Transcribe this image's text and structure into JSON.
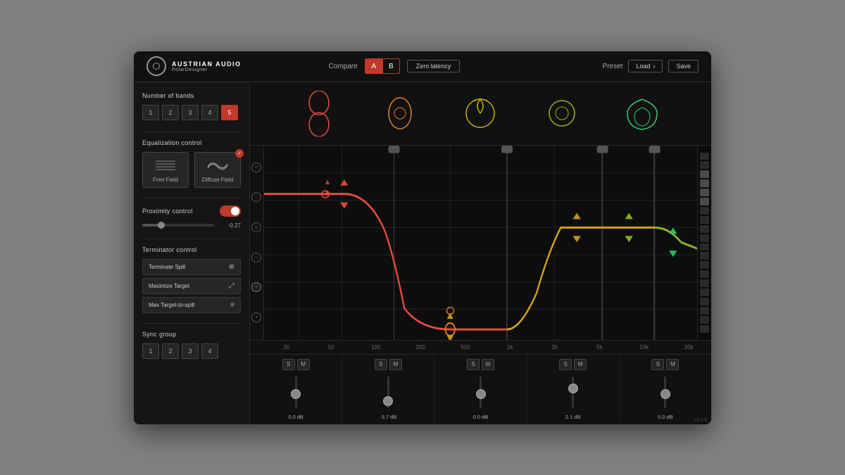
{
  "header": {
    "brand": "AUSTRIAN AUDIO",
    "product": "PolarDesigner",
    "compare_label": "Compare",
    "btn_a": "A",
    "btn_b": "B",
    "zero_latency": "Zero latency",
    "preset_label": "Preset",
    "load_label": "Load",
    "save_label": "Save"
  },
  "sidebar": {
    "number_of_bands_label": "Number of bands",
    "bands": [
      "1",
      "2",
      "3",
      "4",
      "5"
    ],
    "active_band": 5,
    "eq_control_label": "Equalization control",
    "free_field_label": "Free Field",
    "diffuse_field_label": "Diffuse Field",
    "proximity_label": "Proximity control",
    "proximity_enabled": true,
    "proximity_value": "-0.27",
    "terminator_label": "Terminator control",
    "terminate_spill": "Terminate Spill",
    "maximize_target": "Maximize Target",
    "max_target_spill": "Max Target-to-spill",
    "sync_label": "Sync group",
    "sync_buttons": [
      "1",
      "2",
      "3",
      "4"
    ]
  },
  "bands": [
    {
      "color": "#e74c3c",
      "s": "S",
      "m": "M",
      "value": "0.0 dB",
      "fader_pos": 0.5
    },
    {
      "color": "#e67e22",
      "s": "S",
      "m": "M",
      "value": "-3.7 dB",
      "fader_pos": 0.3
    },
    {
      "color": "#f1c40f",
      "s": "S",
      "m": "M",
      "value": "0.0 dB",
      "fader_pos": 0.5
    },
    {
      "color": "#a8c832",
      "s": "S",
      "m": "M",
      "value": "2.1 dB",
      "fader_pos": 0.65
    },
    {
      "color": "#2ecc71",
      "s": "S",
      "m": "M",
      "value": "0.0 dB",
      "fader_pos": 0.5
    }
  ],
  "freq_labels": [
    "20",
    "50",
    "100",
    "200",
    "500",
    "1k",
    "2k",
    "5k",
    "10k",
    "20k"
  ],
  "version": "v3.0.9"
}
